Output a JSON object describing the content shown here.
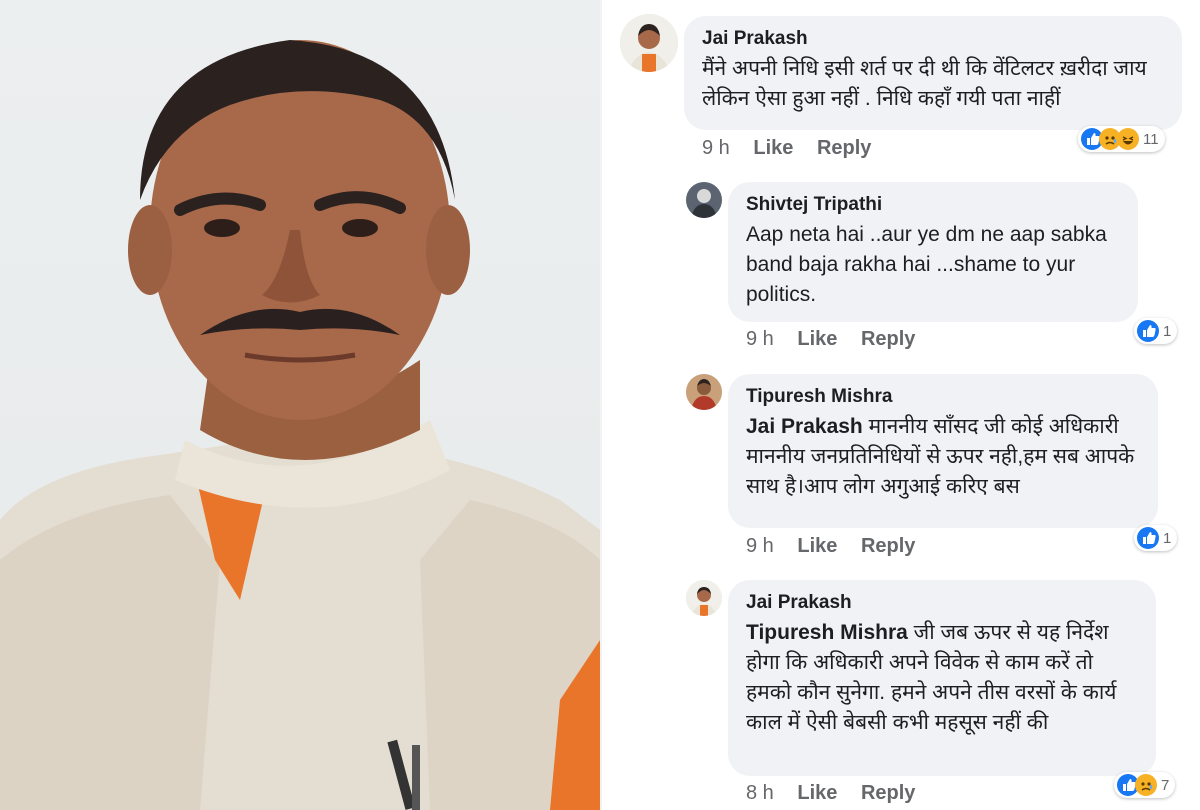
{
  "comments": [
    {
      "author": "Jai Prakash",
      "mention": "",
      "text": "मैंने अपनी निधि इसी शर्त पर दी थी कि वेंटिलटर ख़रीदा जाय लेकिन ऐसा हुआ नहीं . निधि कहाँ गयी पता नाहीं",
      "time": "9 h",
      "like": "Like",
      "reply": "Reply",
      "reactions": [
        "like",
        "sad",
        "haha"
      ],
      "count": "11"
    },
    {
      "author": "Shivtej Tripathi",
      "mention": "",
      "text": "Aap neta hai ..aur ye dm ne aap sabka band baja rakha hai ...shame to yur politics.",
      "time": "9 h",
      "like": "Like",
      "reply": "Reply",
      "reactions": [
        "like"
      ],
      "count": "1"
    },
    {
      "author": "Tipuresh Mishra",
      "mention": "Jai Prakash",
      "text": "माननीय साँसद जी कोई अधिकारी माननीय जनप्रतिनिधियों से ऊपर नही,हम सब आपके साथ है।आप लोग अगुआई करिए बस",
      "time": "9 h",
      "like": "Like",
      "reply": "Reply",
      "reactions": [
        "like"
      ],
      "count": "1"
    },
    {
      "author": "Jai Prakash",
      "mention": "Tipuresh Mishra",
      "text": "जी जब ऊपर से यह निर्देश होगा कि अधिकारी अपने विवेक से काम करें तो हमको कौन सुनेगा. हमने अपने तीस वरसों के कार्य काल में ऐसी बेबसी कभी महसूस नहीं की",
      "time": "8 h",
      "like": "Like",
      "reply": "Reply",
      "reactions": [
        "like",
        "sad"
      ],
      "count": "7"
    }
  ],
  "colors": {
    "like": "#1877f2",
    "sad": "#f7b125",
    "bubble": "#f0f2f5",
    "meta": "#65676b",
    "vest": "#e4ddd1",
    "kurta": "#e8752a"
  }
}
